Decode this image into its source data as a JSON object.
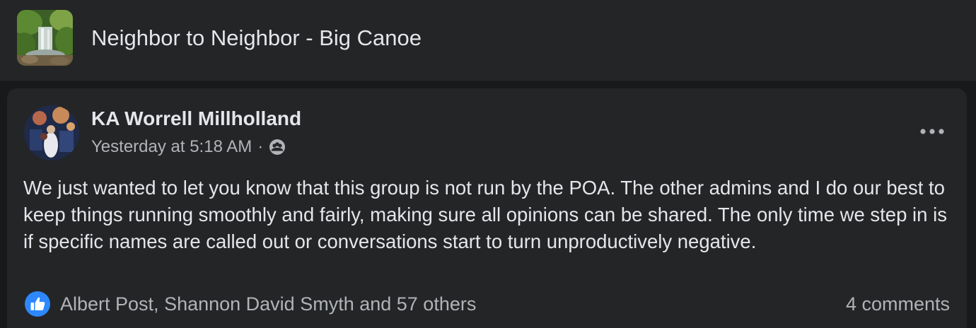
{
  "group": {
    "title": "Neighbor to Neighbor - Big Canoe"
  },
  "post": {
    "author": "KA Worrell Millholland",
    "timestamp": "Yesterday at 5:18 AM",
    "separator": "·",
    "audience_icon": "group-members-icon",
    "body": "We just wanted to let you know that this group is not run by the POA. The other admins and I do our best to keep things running smoothly and fairly, making sure all opinions can be shared. The only time we step in is if specific names are called out or conversations start to turn unproductively negative.",
    "reactions_text": "Albert Post, Shannon David Smyth and 57 others",
    "comments_text": "4 comments"
  },
  "colors": {
    "background": "#18191a",
    "card": "#242526",
    "primary_text": "#e4e6eb",
    "secondary_text": "#b0b3b8",
    "like_blue": "#2d88ff"
  }
}
